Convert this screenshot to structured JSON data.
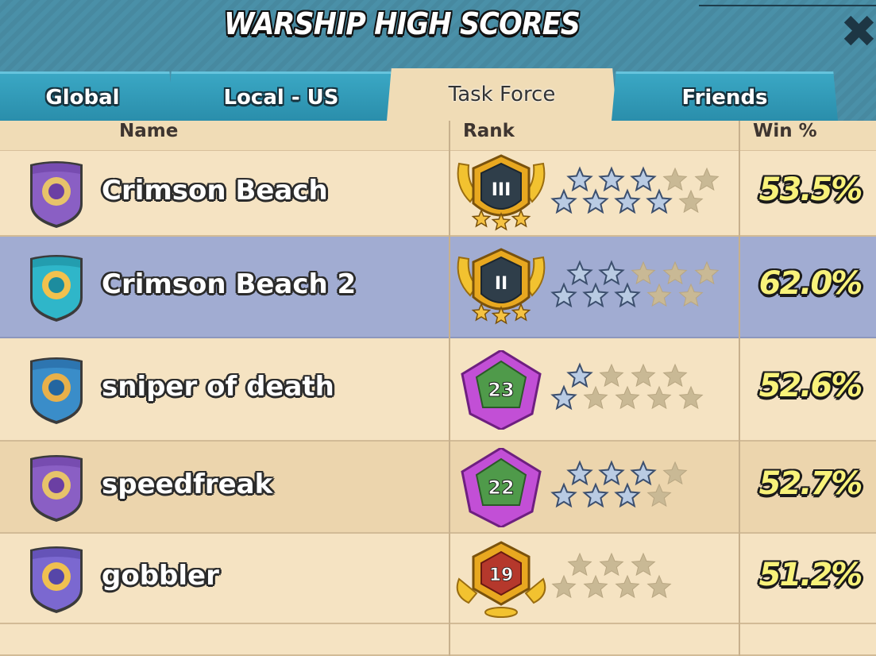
{
  "header": {
    "title": "WARSHIP HIGH SCORES",
    "close_label": "✖"
  },
  "tabs": [
    {
      "label": "Global",
      "active": false
    },
    {
      "label": "Local - US",
      "active": false
    },
    {
      "label": "Task Force",
      "active": true
    },
    {
      "label": "Friends",
      "active": false
    }
  ],
  "columns": {
    "name": "Name",
    "rank": "Rank",
    "win": "Win %"
  },
  "rows": [
    {
      "name": "Crimson Beach",
      "rank_label": "III",
      "rank_kind": "gold-shield",
      "stars_filled": 7,
      "stars_total": 10,
      "win": "53.5%",
      "badge": "wolf-badge-purple",
      "selected": false
    },
    {
      "name": "Crimson Beach 2",
      "rank_label": "II",
      "rank_kind": "gold-shield",
      "stars_filled": 5,
      "stars_total": 10,
      "win": "62.0%",
      "badge": "eagle-badge-teal",
      "selected": true
    },
    {
      "name": "sniper of death",
      "rank_label": "23",
      "rank_kind": "purple-pentagon",
      "stars_filled": 2,
      "stars_total": 9,
      "win": "52.6%",
      "badge": "sword-badge-blue",
      "selected": false
    },
    {
      "name": "speedfreak",
      "rank_label": "22",
      "rank_kind": "purple-pentagon",
      "stars_filled": 6,
      "stars_total": 8,
      "win": "52.7%",
      "badge": "wolf-badge-purple",
      "selected": false
    },
    {
      "name": "gobbler",
      "rank_label": "19",
      "rank_kind": "gold-hexagon",
      "stars_filled": 0,
      "stars_total": 7,
      "win": "51.2%",
      "badge": "fist-badge-purple",
      "selected": false
    }
  ]
}
